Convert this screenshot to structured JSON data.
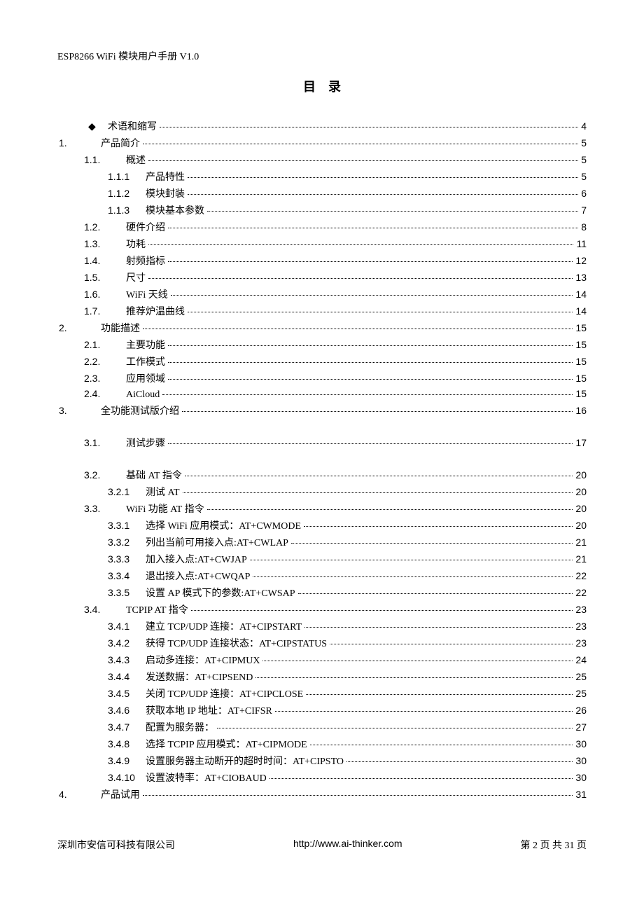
{
  "header": "ESP8266 WiFi 模块用户手册 V1.0",
  "title": "目录",
  "bullet": {
    "symbol": "◆",
    "label": "术语和缩写",
    "page": "4"
  },
  "toc": [
    {
      "lvl": 0,
      "marker": "1.",
      "label": "产品简介",
      "page": "5"
    },
    {
      "lvl": 1,
      "marker": "1.1.",
      "label": "概述",
      "page": "5"
    },
    {
      "lvl": 2,
      "marker": "1.1.1",
      "label": "产品特性",
      "page": "5"
    },
    {
      "lvl": 2,
      "marker": "1.1.2",
      "label": "模块封装",
      "page": "6"
    },
    {
      "lvl": 2,
      "marker": "1.1.3",
      "label": "模块基本参数",
      "page": "7"
    },
    {
      "lvl": 1,
      "marker": "1.2.",
      "label": "硬件介绍",
      "page": "8"
    },
    {
      "lvl": 1,
      "marker": "1.3.",
      "label": "功耗",
      "page": "11"
    },
    {
      "lvl": 1,
      "marker": "1.4.",
      "label": "射频指标",
      "page": "12"
    },
    {
      "lvl": 1,
      "marker": "1.5.",
      "label": "尺寸",
      "page": "13"
    },
    {
      "lvl": 1,
      "marker": "1.6.",
      "label": "WiFi 天线",
      "page": "14"
    },
    {
      "lvl": 1,
      "marker": "1.7.",
      "label": "推荐炉温曲线",
      "page": "14"
    },
    {
      "lvl": 0,
      "marker": "2.",
      "label": "功能描述",
      "page": "15"
    },
    {
      "lvl": 1,
      "marker": "2.1.",
      "label": "主要功能",
      "page": "15"
    },
    {
      "lvl": 1,
      "marker": "2.2.",
      "label": "工作模式",
      "page": "15"
    },
    {
      "lvl": 1,
      "marker": "2.3.",
      "label": "应用领域",
      "page": "15"
    },
    {
      "lvl": 1,
      "marker": "2.4.",
      "label": "AiCloud",
      "page": "15"
    },
    {
      "lvl": 0,
      "marker": "3.",
      "label": "全功能测试版介绍",
      "page": "16",
      "gap": true
    },
    {
      "lvl": 1,
      "marker": "3.1.",
      "label": "测试步骤",
      "page": "17",
      "gap": true
    },
    {
      "lvl": 1,
      "marker": "3.2.",
      "label": "基础 AT 指令",
      "page": "20"
    },
    {
      "lvl": 2,
      "marker": "3.2.1",
      "label": "测试 AT",
      "page": "20"
    },
    {
      "lvl": 1,
      "marker": "3.3.",
      "label": "WiFi 功能 AT 指令",
      "page": "20"
    },
    {
      "lvl": 2,
      "marker": "3.3.1",
      "label": "选择 WiFi 应用模式：AT+CWMODE",
      "page": "20"
    },
    {
      "lvl": 2,
      "marker": "3.3.2",
      "label": "列出当前可用接入点:AT+CWLAP",
      "page": "21"
    },
    {
      "lvl": 2,
      "marker": "3.3.3",
      "label": "加入接入点:AT+CWJAP",
      "page": "21"
    },
    {
      "lvl": 2,
      "marker": "3.3.4",
      "label": "退出接入点:AT+CWQAP",
      "page": "22"
    },
    {
      "lvl": 2,
      "marker": "3.3.5",
      "label": "设置 AP 模式下的参数:AT+CWSAP",
      "page": "22"
    },
    {
      "lvl": 1,
      "marker": "3.4.",
      "label": "TCPIP AT 指令",
      "page": "23"
    },
    {
      "lvl": 2,
      "marker": "3.4.1",
      "label": "建立 TCP/UDP 连接：AT+CIPSTART",
      "page": "23"
    },
    {
      "lvl": 2,
      "marker": "3.4.2",
      "label": "获得 TCP/UDP 连接状态：AT+CIPSTATUS",
      "page": "23"
    },
    {
      "lvl": 2,
      "marker": "3.4.3",
      "label": "启动多连接：AT+CIPMUX",
      "page": "24"
    },
    {
      "lvl": 2,
      "marker": "3.4.4",
      "label": "发送数据：AT+CIPSEND",
      "page": "25"
    },
    {
      "lvl": 2,
      "marker": "3.4.5",
      "label": "关闭 TCP/UDP 连接：AT+CIPCLOSE",
      "page": "25"
    },
    {
      "lvl": 2,
      "marker": "3.4.6",
      "label": "获取本地 IP 地址：AT+CIFSR",
      "page": "26"
    },
    {
      "lvl": 2,
      "marker": "3.4.7",
      "label": "配置为服务器：",
      "page": "27"
    },
    {
      "lvl": 2,
      "marker": "3.4.8",
      "label": "选择 TCPIP 应用模式：AT+CIPMODE",
      "page": "30"
    },
    {
      "lvl": 2,
      "marker": "3.4.9",
      "label": "设置服务器主动断开的超时时间：AT+CIPSTO",
      "page": "30"
    },
    {
      "lvl": 2,
      "marker": "3.4.10",
      "label": "设置波特率：AT+CIOBAUD",
      "page": "30"
    },
    {
      "lvl": 0,
      "marker": "4.",
      "label": "产品试用",
      "page": "31"
    }
  ],
  "footer": {
    "left": "深圳市安信可科技有限公司",
    "center": "http://www.ai-thinker.com",
    "right": "第 2 页 共 31 页"
  }
}
